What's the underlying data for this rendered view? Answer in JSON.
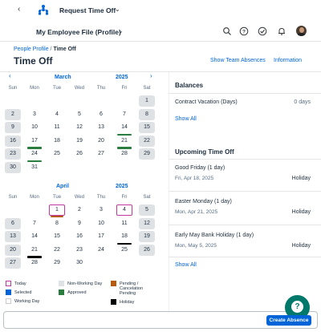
{
  "shell": {
    "title": "Request Time Off",
    "back_icon": "chevron-left-icon",
    "logo_icon": "org-people-icon",
    "title_caret_icon": "chevron-down-icon"
  },
  "subheader": {
    "file_title": "My Employee File (Profile)",
    "icons": [
      "search-icon",
      "help-icon",
      "tasks-icon",
      "notifications-icon",
      "avatar"
    ]
  },
  "page": {
    "breadcrumb_link": "People Profile",
    "breadcrumb_sep": "/",
    "breadcrumb_current": "Time Off",
    "title": "Time Off",
    "show_team_absences": "Show Team Absences",
    "information": "Information"
  },
  "calendar": {
    "dow": [
      "Sun",
      "Mon",
      "Tue",
      "Wed",
      "Thu",
      "Fri",
      "Sat"
    ],
    "march": {
      "month": "March",
      "year": "2025",
      "weeks": [
        [
          "",
          "",
          "",
          "",
          "",
          "",
          "1"
        ],
        [
          "2",
          "3",
          "4",
          "5",
          "6",
          "7",
          "8"
        ],
        [
          "9",
          "10",
          "11",
          "12",
          "13",
          "14",
          "15"
        ],
        [
          "16",
          "17",
          "18",
          "19",
          "20",
          "21",
          "22"
        ],
        [
          "23",
          "24",
          "25",
          "26",
          "27",
          "28",
          "29"
        ],
        [
          "30",
          "31",
          "",
          "",
          "",
          "",
          ""
        ]
      ]
    },
    "april": {
      "month": "April",
      "year": "2025",
      "weeks": [
        [
          "",
          "",
          "1",
          "2",
          "3",
          "4",
          "5"
        ],
        [
          "6",
          "7",
          "8",
          "9",
          "10",
          "11",
          "12"
        ],
        [
          "13",
          "14",
          "15",
          "16",
          "17",
          "18",
          "19"
        ],
        [
          "20",
          "21",
          "22",
          "23",
          "24",
          "25",
          "26"
        ],
        [
          "27",
          "28",
          "29",
          "30",
          "",
          "",
          ""
        ]
      ]
    },
    "colors": {
      "approved": "#2b7d3f",
      "pending": "#b85a0e",
      "holiday": "#000000",
      "today": "#c0399f",
      "selected": "#0064d9",
      "non_working": "#dfe2e5"
    }
  },
  "legend": {
    "today": "Today",
    "non_working_day": "Non-Working Day",
    "pending_1": "Pending /",
    "pending_2": "Cancelation",
    "pending_3": "Pending",
    "selected": "Selected",
    "approved": "Approved",
    "working_day": "Working Day",
    "holiday": "Holiday"
  },
  "balances": {
    "title": "Balances",
    "item_label": "Contract Vacation (Days)",
    "item_value": "0 days",
    "show_all": "Show All"
  },
  "upcoming": {
    "title": "Upcoming Time Off",
    "items": [
      {
        "name": "Good Friday (1 day)",
        "date": "Fri, Apr 18, 2025",
        "type": "Holiday"
      },
      {
        "name": "Easter Monday (1 day)",
        "date": "Mon, Apr 21, 2025",
        "type": "Holiday"
      },
      {
        "name": "Early May Bank Holiday (1 day)",
        "date": "Mon, May 5, 2025",
        "type": "Holiday"
      }
    ],
    "show_all": "Show All"
  },
  "footer": {
    "create_absence": "Create Absence",
    "help_icon": "question-icon"
  }
}
